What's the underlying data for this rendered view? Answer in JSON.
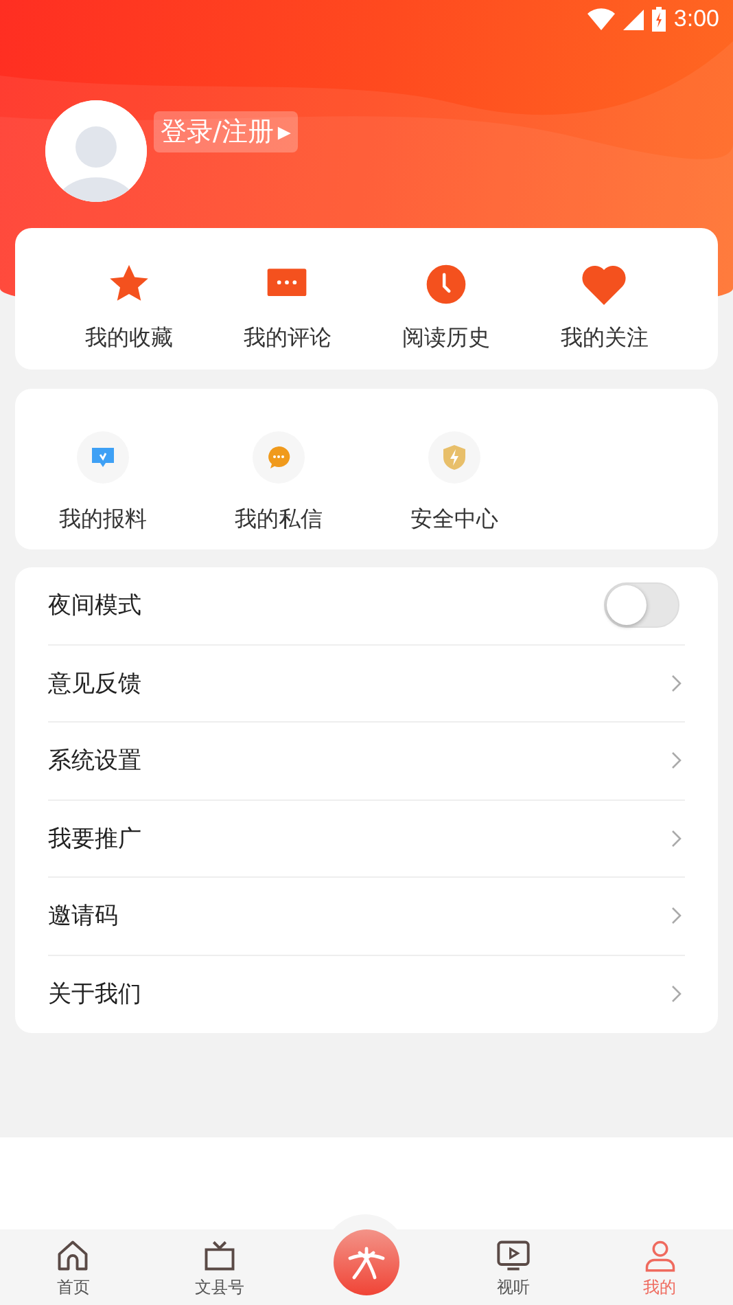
{
  "status_bar": {
    "time": "3:00"
  },
  "profile": {
    "login_label": "登录/注册",
    "arrow": "▸"
  },
  "quick_links": [
    {
      "label": "我的收藏",
      "kind": "star"
    },
    {
      "label": "我的评论",
      "kind": "comment"
    },
    {
      "label": "阅读历史",
      "kind": "clock"
    },
    {
      "label": "我的关注",
      "kind": "heart"
    }
  ],
  "tools": [
    {
      "label": "我的报料",
      "kind": "report"
    },
    {
      "label": "我的私信",
      "kind": "message"
    },
    {
      "label": "安全中心",
      "kind": "shield"
    }
  ],
  "settings": [
    {
      "label": "夜间模式",
      "kind": "toggle",
      "on": false
    },
    {
      "label": "意见反馈",
      "kind": "link"
    },
    {
      "label": "系统设置",
      "kind": "link"
    },
    {
      "label": "我要推广",
      "kind": "link"
    },
    {
      "label": "邀请码",
      "kind": "link"
    },
    {
      "label": "关于我们",
      "kind": "link"
    }
  ],
  "tab_bar": [
    {
      "label": "首页",
      "kind": "home",
      "selected": false
    },
    {
      "label": "文县号",
      "kind": "tv",
      "selected": false
    },
    {
      "kind": "logo",
      "selected": false
    },
    {
      "label": "视听",
      "kind": "video",
      "selected": false
    },
    {
      "label": "我的",
      "kind": "person",
      "selected": true
    }
  ]
}
